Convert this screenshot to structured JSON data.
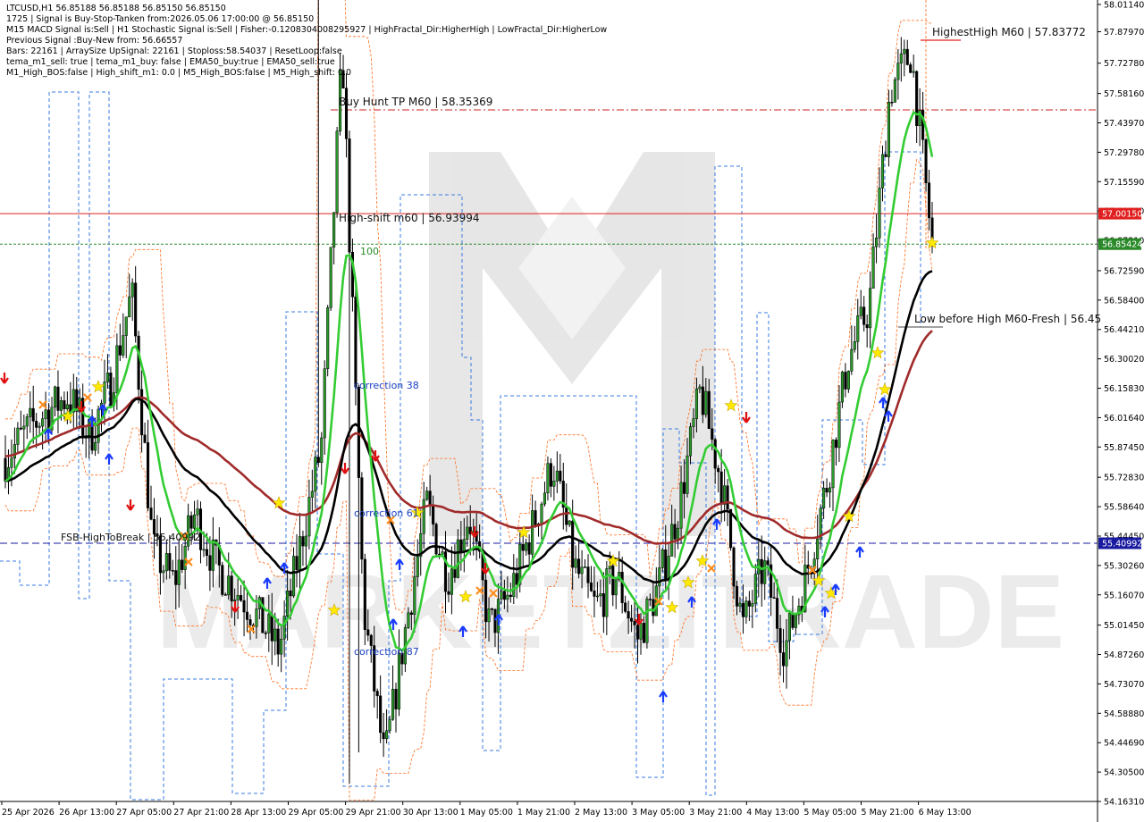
{
  "info": {
    "lines": [
      "LTCUSD,H1  56.85188 56.85188 56.85150 56.85150",
      "1725  |  Signal is Buy-Stop-Tanken from:2026.05.06 17:00:00 @ 56.85150",
      "M15 MACD Signal is:Sell  |  H1 Stochastic Signal is:Sell  |  Fisher:-0.1208304008295927  |  HighFractal_Dir:HigherHigh  |  LowFractal_Dir:HigherLow",
      "Previous Signal :Buy-New from: 56.66557",
      "Bars: 22161  |  ArraySize UpSignal: 22161  |  Stoploss:58.54037  |  ResetLoop:false",
      "tema_m1_sell: true  |  tema_m1_buy: false  |  EMA50_buy:true  |  EMA50_sell:true",
      "M1_High_BOS:false  |  High_shift_m1: 0.0  |  M5_High_BOS:false  |  M5_High_shift: 0.0"
    ]
  },
  "watermark": "MARKETZITRADE",
  "colors": {
    "bull": "#000000",
    "bear": "#000000",
    "green_ma": "#33cc33",
    "black_ma": "#000000",
    "brown_ma": "#a02a2a",
    "blue_env": "#3a7be0",
    "orange_env": "#ff6a1a",
    "red_level": "#e02020",
    "green_level": "#2a8a2a",
    "navy_level": "#1a1aa0",
    "tp_line": "#cc2020"
  },
  "levels": {
    "buy_hunt_tp": {
      "label": "Buy Hunt TP M60 | 58.35369",
      "value": 57.52
    },
    "high_shift": {
      "label": "High-shift m60 | 56.93994",
      "value": 57.0015
    },
    "highest_high": {
      "label": "HighestHigh   M60 | 57.83772",
      "value": 57.84
    },
    "low_before_high": {
      "label": "Low before High   M60-Fresh | 56.45",
      "value": 56.45
    },
    "current": {
      "value": 56.85424
    },
    "fsb": {
      "label": "FSB-HighToBreak | 55.40992",
      "value": 55.40992
    },
    "label_100": "100",
    "correction_38": "correction 38",
    "correction_61": "correction 61",
    "correction_87": "correction 87"
  },
  "price_tags": [
    {
      "text": "57.00150",
      "value": 57.0015,
      "color": "#e02020"
    },
    {
      "text": "56.85424",
      "value": 56.85424,
      "color": "#2a8a2a"
    },
    {
      "text": "55.40992",
      "value": 55.40992,
      "color": "#1a1aa0"
    }
  ],
  "chart_data": {
    "type": "candlestick",
    "symbol": "LTCUSD,H1",
    "ylim": [
      54.1631,
      58.0114
    ],
    "y_ticks": [
      "58.01140",
      "57.87970",
      "57.72780",
      "57.58160",
      "57.43970",
      "57.29780",
      "57.15590",
      "57.01400",
      "56.87210",
      "56.72590",
      "56.58400",
      "56.44210",
      "56.30020",
      "56.15830",
      "56.01640",
      "55.87450",
      "55.72830",
      "55.58640",
      "55.44450",
      "55.30260",
      "55.16070",
      "55.01450",
      "54.87260",
      "54.73070",
      "54.58880",
      "54.44690",
      "54.30500",
      "54.16310"
    ],
    "x_ticks": [
      "25 Apr 2026",
      "26 Apr 13:00",
      "27 Apr 05:00",
      "27 Apr 21:00",
      "28 Apr 13:00",
      "29 Apr 05:00",
      "29 Apr 21:00",
      "30 Apr 13:00",
      "1 May 05:00",
      "1 May 21:00",
      "2 May 13:00",
      "3 May 05:00",
      "3 May 21:00",
      "4 May 13:00",
      "5 May 05:00",
      "5 May 21:00",
      "6 May 13:00"
    ],
    "approx_close_path": [
      55.82,
      55.95,
      56.05,
      56.12,
      55.92,
      56.18,
      56.62,
      55.38,
      55.22,
      55.55,
      55.3,
      55.18,
      55.05,
      54.9,
      55.4,
      55.88,
      57.8,
      55.1,
      54.35,
      55.0,
      55.6,
      55.25,
      55.55,
      55.0,
      55.18,
      55.48,
      55.8,
      55.3,
      55.1,
      55.25,
      54.95,
      55.2,
      55.6,
      56.15,
      55.7,
      55.0,
      55.3,
      54.9,
      55.25,
      55.7,
      56.3,
      56.55,
      57.6,
      57.78,
      56.85
    ]
  }
}
